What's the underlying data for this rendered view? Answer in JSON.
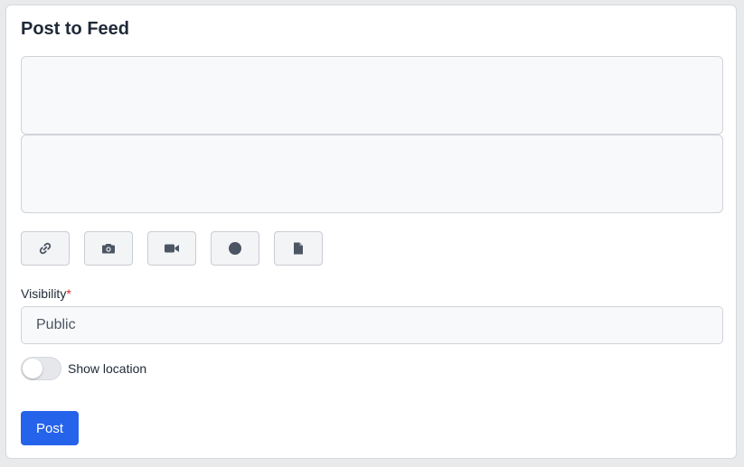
{
  "form": {
    "title": "Post to Feed",
    "textarea_1": {
      "value": "",
      "placeholder": ""
    },
    "textarea_2": {
      "value": "",
      "placeholder": ""
    },
    "attachments": [
      {
        "icon": "link-icon"
      },
      {
        "icon": "camera-icon"
      },
      {
        "icon": "video-icon"
      },
      {
        "icon": "record-icon"
      },
      {
        "icon": "document-icon"
      }
    ],
    "visibility": {
      "label": "Visibility",
      "required_marker": "*",
      "selected": "Public"
    },
    "location_toggle": {
      "label": "Show location",
      "checked": false
    },
    "submit_label": "Post"
  },
  "colors": {
    "primary": "#2563eb",
    "required": "#dc2626",
    "icon": "#4b5563",
    "field_bg": "#f8f9fa"
  }
}
